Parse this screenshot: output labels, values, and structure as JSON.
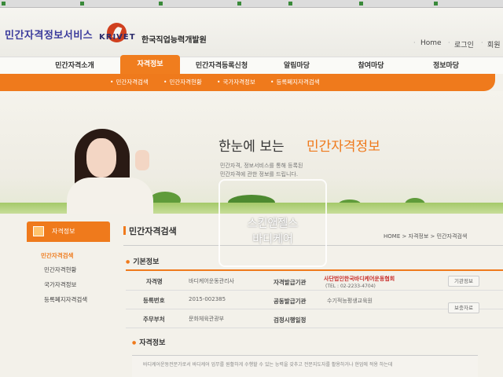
{
  "header": {
    "site_title": "민간자격정보서비스",
    "krivet": "KRIVET",
    "org_name": "한국직업능력개발원",
    "util_links": [
      "Home",
      "로그인",
      "회원"
    ]
  },
  "nav": {
    "items": [
      "민간자격소개",
      "자격정보",
      "민간자격등록신청",
      "알림마당",
      "참여마당",
      "정보마당"
    ],
    "active": "자격정보"
  },
  "subnav": {
    "items": [
      "민간자격검색",
      "민간자격현황",
      "국가자격정보",
      "등록폐지자격검색"
    ]
  },
  "hero": {
    "title": "한눈에 보는",
    "highlight": "민간자격정보",
    "desc_line1": "민간자격, 정보서비스를 통해 등록된",
    "desc_line2": "민간자격에 관한 정보를 드립니다."
  },
  "watermark": {
    "line1": "스킨앤젤스",
    "line2": "바디케어"
  },
  "sidebar": {
    "title": "자격정보",
    "items": [
      "민간자격검색",
      "민간자격현황",
      "국가자격정보",
      "등록폐지자격검색"
    ],
    "active": "민간자격검색"
  },
  "content": {
    "title": "민간자격검색",
    "breadcrumb": "HOME  >  자격정보  >  민간자격검색",
    "basic_info_title": "기본정보",
    "qual_info_title": "자격정보",
    "rows": {
      "name_label": "자격명",
      "name_value": "바디케어운동관리사",
      "issuer_label": "자격발급기관",
      "issuer_value": "사단법인한국바디케어운동협회",
      "tel_value": "(TEL : 02-2233-4704)",
      "reg_label": "등록번호",
      "reg_value": "2015-002385",
      "co_label": "공동발급기관",
      "co_value": "수기적능평생교육원",
      "dept_label": "주무부처",
      "dept_value": "문화체육관광부",
      "org_label": "검정시행일정"
    },
    "btn_org_info": "기관정보",
    "btn_more": "보충자료",
    "qual_desc": "바디케어운동전문가로서 바디케어 업무를 원활하게 수행할 수 있는 능력을 갖추고 전문지도자를 활용하거나 현업에 적용 하는데"
  }
}
